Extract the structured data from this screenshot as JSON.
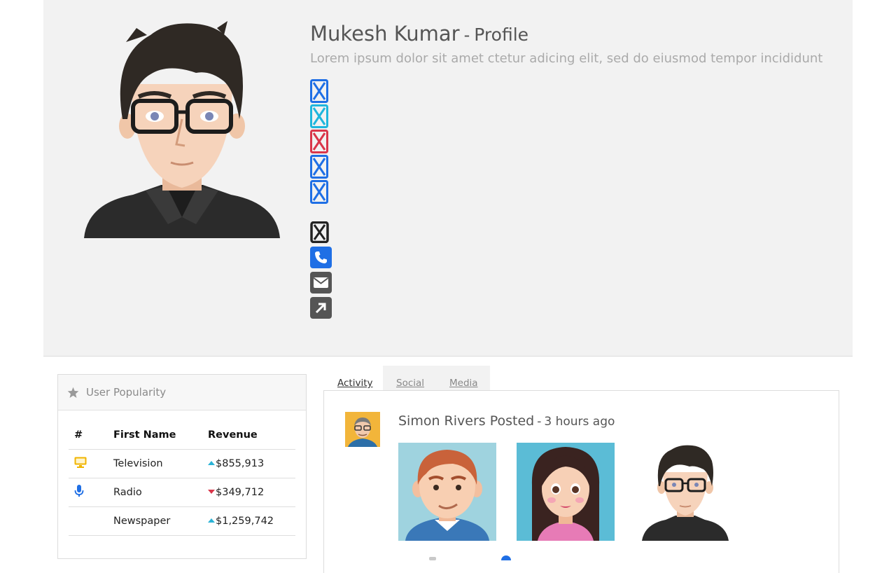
{
  "profile": {
    "name": "Mukesh Kumar",
    "title_suffix": "Profile",
    "separator": "-",
    "subtitle": "Lorem ipsum dolor sit amet ctetur adicing elit, sed do eiusmod tempor incididunt",
    "avatar_icon": "cartoon-man-glasses-avatar",
    "social_icons": [
      {
        "name": "broken-social-icon-1",
        "color": "#1f6fe5"
      },
      {
        "name": "broken-social-icon-2",
        "color": "#1fb6dd"
      },
      {
        "name": "broken-social-icon-3",
        "color": "#d9364a"
      },
      {
        "name": "broken-social-icon-4",
        "color": "#1f6fe5"
      },
      {
        "name": "broken-social-icon-5",
        "color": "#1f6fe5"
      }
    ],
    "contact_icons": [
      {
        "name": "broken-icon",
        "color": "#222222"
      },
      {
        "name": "phone-icon",
        "color": "#1f6fe5"
      },
      {
        "name": "envelope-icon",
        "color": "#555555"
      },
      {
        "name": "external-link-icon",
        "color": "#555555"
      }
    ]
  },
  "popularity": {
    "title": "User Popularity",
    "icon": "star-icon",
    "headers": [
      "#",
      "First Name",
      "Revenue"
    ],
    "rows": [
      {
        "icon": "monitor-icon",
        "icon_color": "#f0b400",
        "name": "Television",
        "trend": "up",
        "revenue": "$855,913"
      },
      {
        "icon": "microphone-icon",
        "icon_color": "#1f6fe5",
        "name": "Radio",
        "trend": "down",
        "revenue": "$349,712"
      },
      {
        "icon": "",
        "icon_color": "",
        "name": "Newspaper",
        "trend": "up",
        "revenue": "$1,259,742"
      }
    ],
    "trend_colors": {
      "up": "#2bb3d6",
      "down": "#d9364a"
    }
  },
  "tabs": [
    {
      "label": "Activity",
      "active": true
    },
    {
      "label": "Social",
      "active": false
    },
    {
      "label": "Media",
      "active": false
    }
  ],
  "activity": {
    "poster": "Simon Rivers Posted",
    "separator": "-",
    "time": "3 hours ago",
    "photos": [
      "red-haired-man-avatar",
      "dark-haired-woman-avatar",
      "man-glasses-avatar"
    ]
  }
}
